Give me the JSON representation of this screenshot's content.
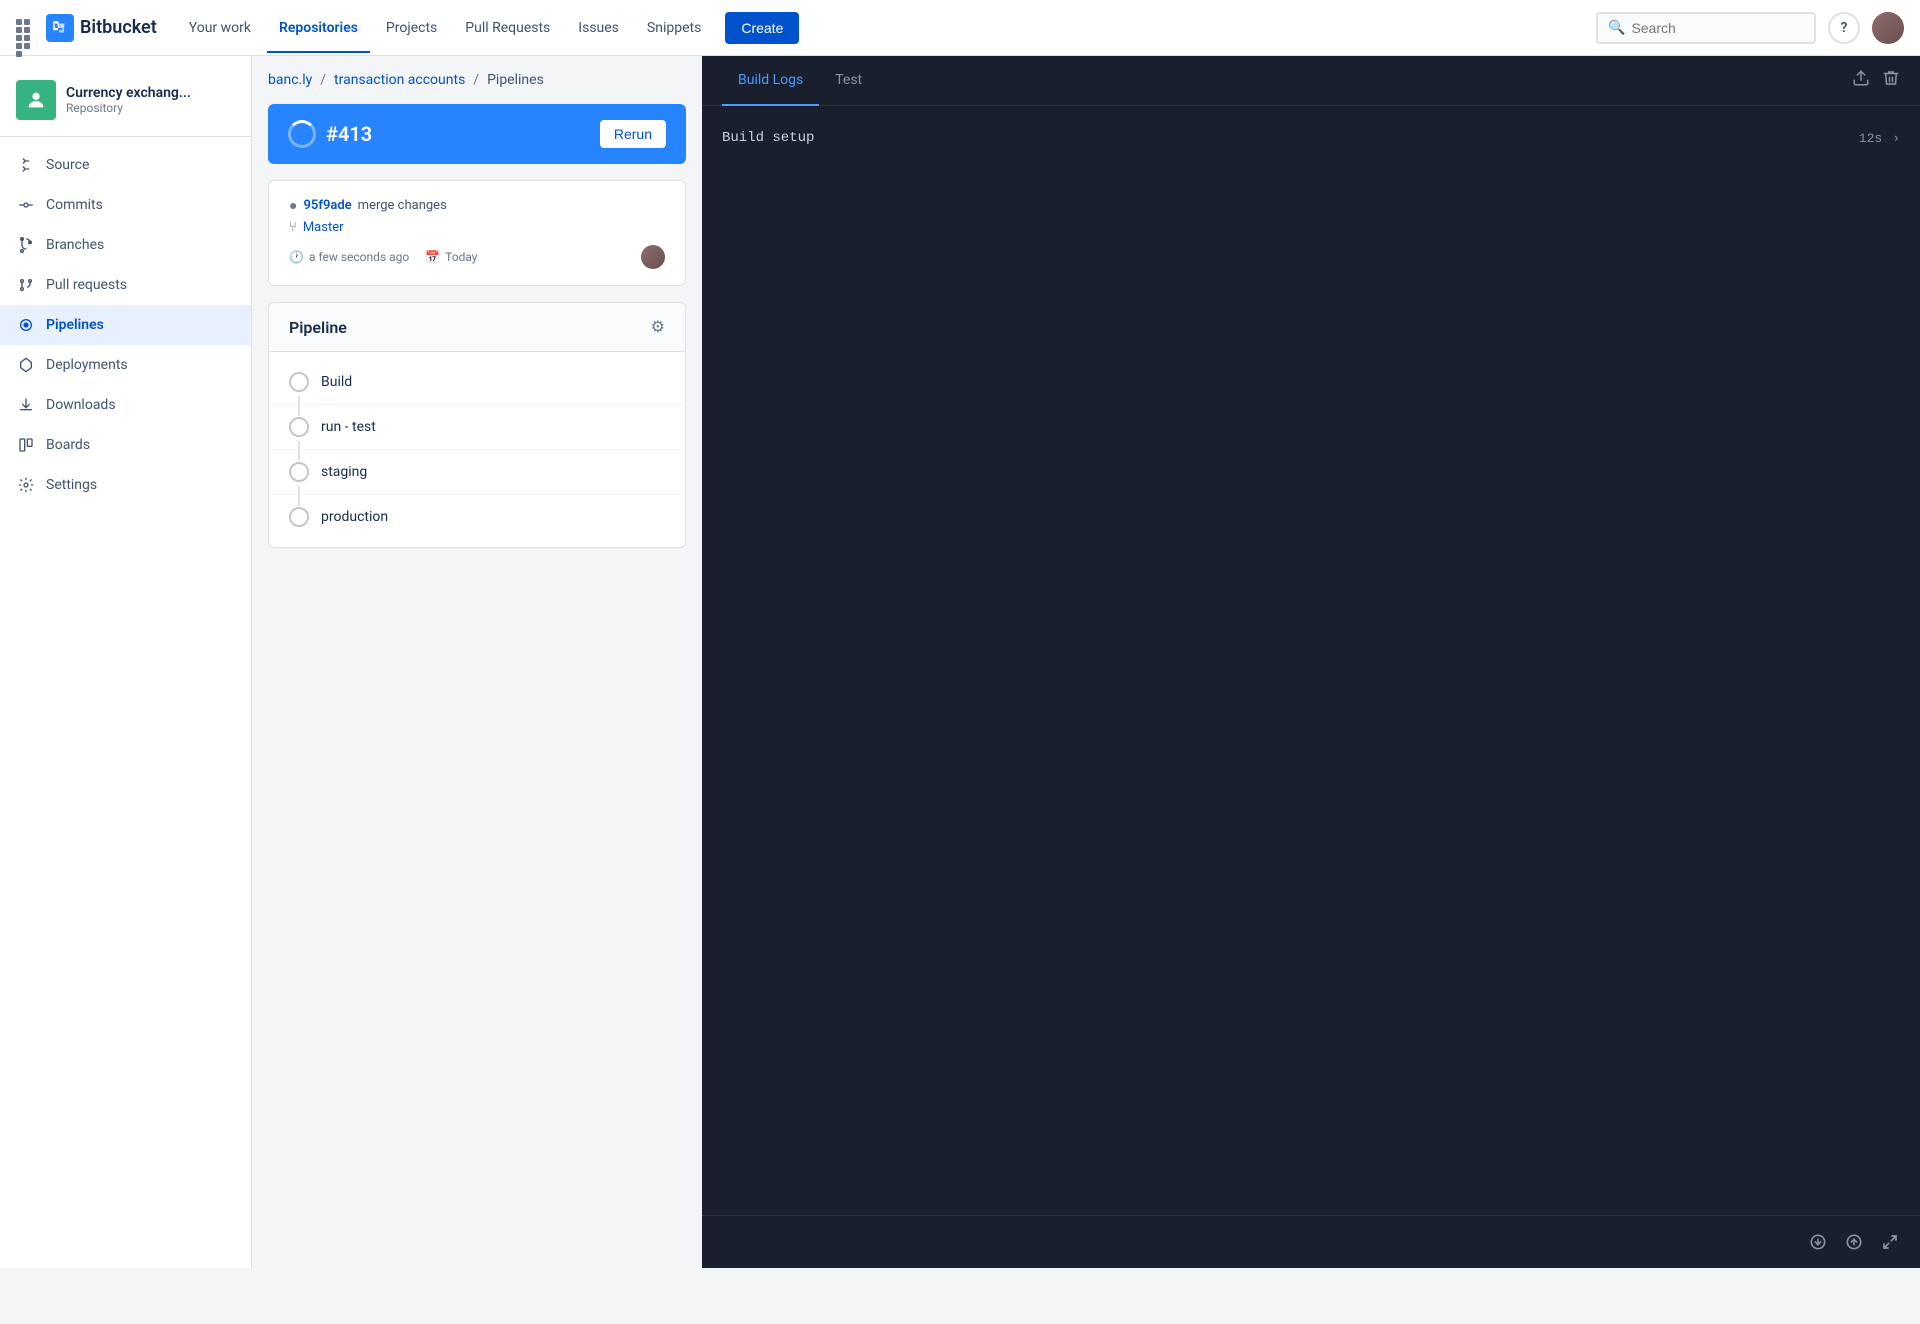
{
  "topnav": {
    "logo_text": "Bitbucket",
    "links": [
      {
        "id": "your-work",
        "label": "Your work",
        "active": false
      },
      {
        "id": "repositories",
        "label": "Repositories",
        "active": true
      },
      {
        "id": "projects",
        "label": "Projects",
        "active": false
      },
      {
        "id": "pull-requests",
        "label": "Pull Requests",
        "active": false
      },
      {
        "id": "issues",
        "label": "Issues",
        "active": false
      },
      {
        "id": "snippets",
        "label": "Snippets",
        "active": false
      }
    ],
    "create_label": "Create",
    "search_placeholder": "Search"
  },
  "sidebar": {
    "repo_name": "Currency exchang...",
    "repo_type": "Repository",
    "nav_items": [
      {
        "id": "source",
        "label": "Source"
      },
      {
        "id": "commits",
        "label": "Commits"
      },
      {
        "id": "branches",
        "label": "Branches"
      },
      {
        "id": "pull-requests",
        "label": "Pull requests"
      },
      {
        "id": "pipelines",
        "label": "Pipelines",
        "active": true
      },
      {
        "id": "deployments",
        "label": "Deployments"
      },
      {
        "id": "downloads",
        "label": "Downloads"
      },
      {
        "id": "boards",
        "label": "Boards"
      },
      {
        "id": "settings",
        "label": "Settings"
      }
    ]
  },
  "breadcrumb": {
    "parts": [
      {
        "label": "banc.ly",
        "link": true
      },
      {
        "label": "transaction accounts",
        "link": true
      },
      {
        "label": "Pipelines",
        "link": false
      }
    ]
  },
  "build": {
    "number": "#413",
    "rerun_label": "Rerun",
    "commit_hash": "95f9ade",
    "commit_message": "merge changes",
    "branch": "Master",
    "time": "a few seconds ago",
    "date": "Today"
  },
  "pipeline": {
    "title": "Pipeline",
    "steps": [
      {
        "id": "build",
        "label": "Build"
      },
      {
        "id": "run-test",
        "label": "run - test"
      },
      {
        "id": "staging",
        "label": "staging"
      },
      {
        "id": "production",
        "label": "production"
      }
    ]
  },
  "logs": {
    "tab_build_logs": "Build Logs",
    "tab_test": "Test",
    "log_row": {
      "title": "Build setup",
      "time": "12s"
    }
  }
}
